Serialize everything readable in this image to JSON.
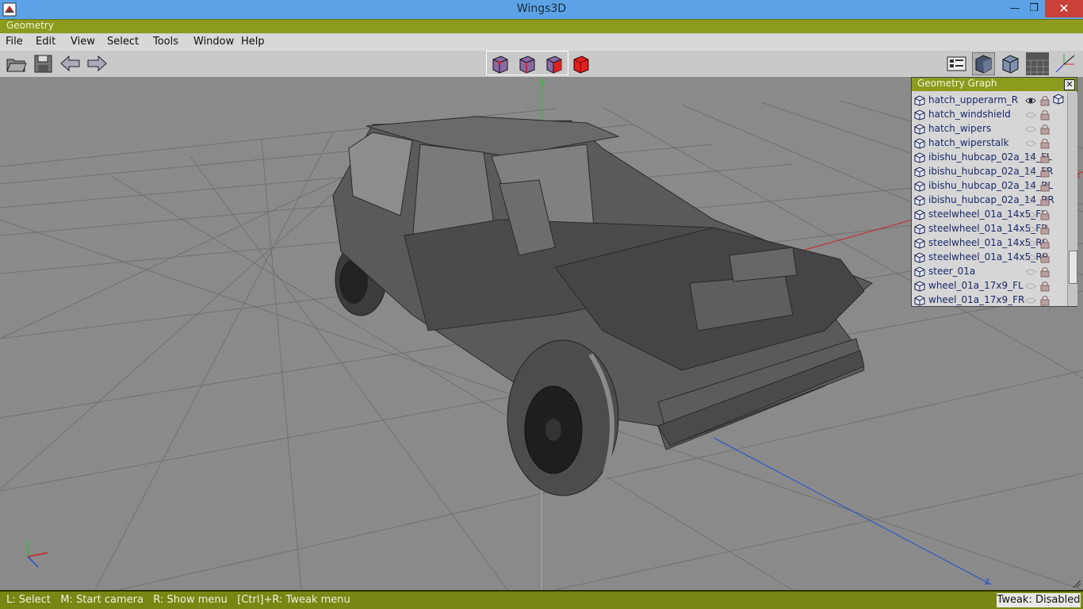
{
  "window": {
    "title": "Wings3D",
    "minimize": "—",
    "maximize": "❐",
    "close": "✕"
  },
  "geometry_title": "Geometry",
  "menu": [
    "File",
    "Edit",
    "View",
    "Select",
    "Tools",
    "Window",
    "Help"
  ],
  "graph": {
    "title": "Geometry Graph",
    "close": "✕",
    "items": [
      {
        "name": "hatch_upperarm_R",
        "visible": true
      },
      {
        "name": "hatch_windshield",
        "visible": false
      },
      {
        "name": "hatch_wipers",
        "visible": false
      },
      {
        "name": "hatch_wiperstalk",
        "visible": false
      },
      {
        "name": "ibishu_hubcap_02a_14_FL",
        "visible": false
      },
      {
        "name": "ibishu_hubcap_02a_14_FR",
        "visible": false
      },
      {
        "name": "ibishu_hubcap_02a_14_RL",
        "visible": false
      },
      {
        "name": "ibishu_hubcap_02a_14_RR",
        "visible": false
      },
      {
        "name": "steelwheel_01a_14x5_FL",
        "visible": false
      },
      {
        "name": "steelwheel_01a_14x5_FR",
        "visible": false
      },
      {
        "name": "steelwheel_01a_14x5_RL",
        "visible": false
      },
      {
        "name": "steelwheel_01a_14x5_RR",
        "visible": false
      },
      {
        "name": "steer_01a",
        "visible": false
      },
      {
        "name": "wheel_01a_17x9_FL",
        "visible": false
      },
      {
        "name": "wheel_01a_17x9_FR",
        "visible": false
      }
    ]
  },
  "axis_labels": {
    "x": "x",
    "y": "y",
    "z": "z"
  },
  "status": {
    "text": "L: Select   M: Start camera   R: Show menu   [Ctrl]+R: Tweak menu",
    "tweak": "Tweak: Disabled"
  },
  "colors": {
    "accent": "#8c9b1e",
    "titlebar": "#5ba3e6",
    "x_axis": "#d22020",
    "y_axis": "#30c030",
    "z_axis": "#2050d0"
  }
}
